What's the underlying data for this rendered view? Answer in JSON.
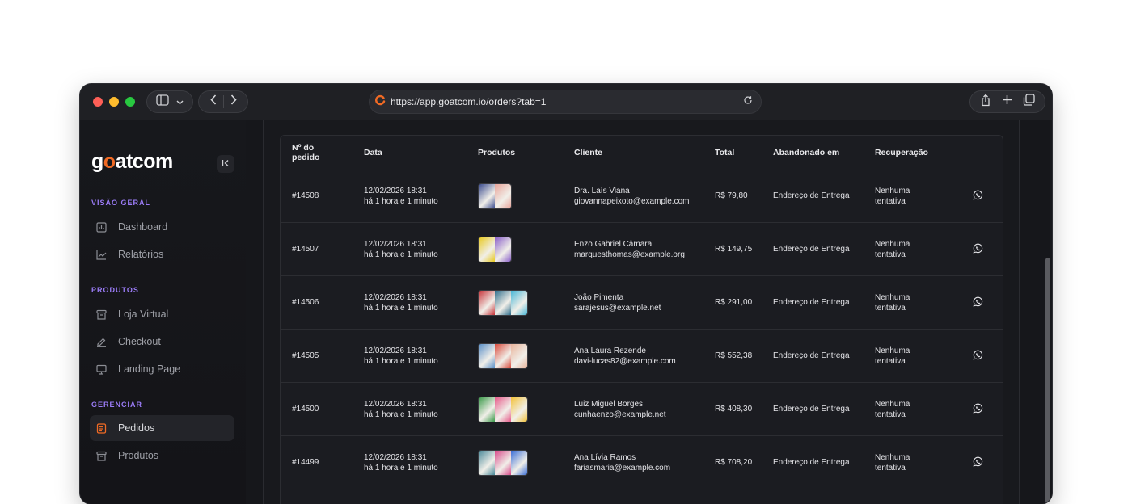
{
  "browser": {
    "url": "https://app.goatcom.io/orders?tab=1"
  },
  "sidebar": {
    "logo_prefix": "g",
    "logo_o": "o",
    "logo_suffix": "atcom",
    "sections": [
      {
        "title": "VISÃO GERAL"
      },
      {
        "title": "PRODUTOS"
      },
      {
        "title": "GERENCIAR"
      }
    ],
    "items": [
      {
        "label": "Dashboard",
        "icon": "dashboard-icon"
      },
      {
        "label": "Relatórios",
        "icon": "chart-line-icon"
      },
      {
        "label": "Loja Virtual",
        "icon": "store-icon"
      },
      {
        "label": "Checkout",
        "icon": "pencil-icon"
      },
      {
        "label": "Landing Page",
        "icon": "monitor-icon"
      },
      {
        "label": "Pedidos",
        "icon": "orders-icon",
        "active": true
      },
      {
        "label": "Produtos",
        "icon": "box-icon"
      }
    ]
  },
  "colors": {
    "accent_orange": "#f06a24",
    "section_purple": "#9b7cf7",
    "background": "#16171b"
  },
  "table": {
    "headers": {
      "order_line1": "Nº do",
      "order_line2": "pedido",
      "date": "Data",
      "products": "Produtos",
      "client": "Cliente",
      "total": "Total",
      "abandoned": "Abandonado em",
      "recovery": "Recuperação"
    },
    "rows": [
      {
        "id": "#14508",
        "date": "12/02/2026 18:31",
        "ago": "há 1 hora e 1 minuto",
        "name": "Dra. Laís Viana",
        "email": "giovannapeixoto@example.com",
        "total": "R$ 79,80",
        "abandoned": "Endereço de Entrega",
        "rec1": "Nenhuma",
        "rec2": "tentativa",
        "thumbs": [
          "#3b4c8f",
          "#e8a49a"
        ]
      },
      {
        "id": "#14507",
        "date": "12/02/2026 18:31",
        "ago": "há 1 hora e 1 minuto",
        "name": "Enzo Gabriel Câmara",
        "email": "marquesthomas@example.org",
        "total": "R$ 149,75",
        "abandoned": "Endereço de Entrega",
        "rec1": "Nenhuma",
        "rec2": "tentativa",
        "thumbs": [
          "#e8c91f",
          "#8a5fc9"
        ]
      },
      {
        "id": "#14506",
        "date": "12/02/2026 18:31",
        "ago": "há 1 hora e 1 minuto",
        "name": "João Pimenta",
        "email": "sarajesus@example.net",
        "total": "R$ 291,00",
        "abandoned": "Endereço de Entrega",
        "rec1": "Nenhuma",
        "rec2": "tentativa",
        "thumbs": [
          "#c8343a",
          "#2f6e8c",
          "#48b7d6"
        ]
      },
      {
        "id": "#14505",
        "date": "12/02/2026 18:31",
        "ago": "há 1 hora e 1 minuto",
        "name": "Ana Laura Rezende",
        "email": "davi-lucas82@example.com",
        "total": "R$ 552,38",
        "abandoned": "Endereço de Entrega",
        "rec1": "Nenhuma",
        "rec2": "tentativa",
        "thumbs": [
          "#5a8fc8",
          "#d94a3c",
          "#e9b49c"
        ]
      },
      {
        "id": "#14500",
        "date": "12/02/2026 18:31",
        "ago": "há 1 hora e 1 minuto",
        "name": "Luiz Miguel Borges",
        "email": "cunhaenzo@example.net",
        "total": "R$ 408,30",
        "abandoned": "Endereço de Entrega",
        "rec1": "Nenhuma",
        "rec2": "tentativa",
        "thumbs": [
          "#3c9a4a",
          "#e65a8a",
          "#f2c23a"
        ]
      },
      {
        "id": "#14499",
        "date": "12/02/2026 18:31",
        "ago": "há 1 hora e 1 minuto",
        "name": "Ana Lívia Ramos",
        "email": "fariasmaria@example.com",
        "total": "R$ 708,20",
        "abandoned": "Endereço de Entrega",
        "rec1": "Nenhuma",
        "rec2": "tentativa",
        "thumbs": [
          "#4c8a9a",
          "#d84a8a",
          "#3a6ed6"
        ]
      }
    ]
  }
}
